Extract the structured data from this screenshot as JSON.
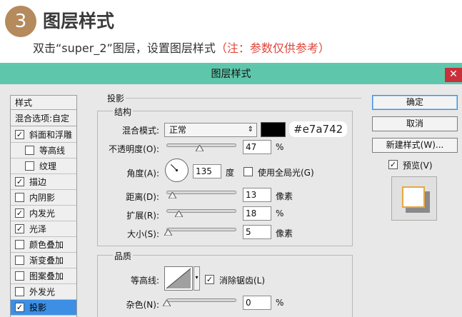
{
  "header": {
    "step_number": "3",
    "step_title": "图层样式",
    "description": "双击“super_2”图层，设置图层样式",
    "note": "（注：参数仅供参考）"
  },
  "dialog": {
    "title": "图层样式",
    "close_glyph": "✕",
    "styles_list": {
      "header": "样式",
      "blend_options": "混合选项:自定",
      "items": [
        {
          "label": "斜面和浮雕",
          "checked": true,
          "indent": false,
          "selected": false
        },
        {
          "label": "等高线",
          "checked": false,
          "indent": true,
          "selected": false
        },
        {
          "label": "纹理",
          "checked": false,
          "indent": true,
          "selected": false
        },
        {
          "label": "描边",
          "checked": true,
          "indent": false,
          "selected": false
        },
        {
          "label": "内阴影",
          "checked": false,
          "indent": false,
          "selected": false
        },
        {
          "label": "内发光",
          "checked": true,
          "indent": false,
          "selected": false
        },
        {
          "label": "光泽",
          "checked": true,
          "indent": false,
          "selected": false
        },
        {
          "label": "颜色叠加",
          "checked": false,
          "indent": false,
          "selected": false
        },
        {
          "label": "渐变叠加",
          "checked": false,
          "indent": false,
          "selected": false
        },
        {
          "label": "图案叠加",
          "checked": false,
          "indent": false,
          "selected": false
        },
        {
          "label": "外发光",
          "checked": false,
          "indent": false,
          "selected": false
        },
        {
          "label": "投影",
          "checked": true,
          "indent": false,
          "selected": true
        }
      ]
    },
    "shadow": {
      "section_title": "投影",
      "structure_title": "结构",
      "blend_mode_label": "混合模式:",
      "blend_mode_value": "正常",
      "color_hex_label": "#e7a742",
      "swatch_color": "#000000",
      "opacity_label": "不透明度(O):",
      "opacity_value": "47",
      "opacity_fraction": 0.47,
      "percent": "%",
      "angle_label": "角度(A):",
      "angle_value": "135",
      "angle_unit": "度",
      "global_light_label": "使用全局光(G)",
      "global_light_checked": false,
      "distance_label": "距离(D):",
      "distance_value": "13",
      "distance_fraction": 0.09,
      "pixel_unit": "像素",
      "spread_label": "扩展(R):",
      "spread_value": "18",
      "spread_fraction": 0.18,
      "size_label": "大小(S):",
      "size_value": "5",
      "size_fraction": 0.03,
      "quality_title": "品质",
      "contour_label": "等高线:",
      "antialias_label": "消除锯齿(L)",
      "antialias_checked": true,
      "noise_label": "杂色(N):",
      "noise_value": "0",
      "noise_fraction": 0.0
    },
    "buttons": {
      "ok": "确定",
      "cancel": "取消",
      "new_style": "新建样式(W)...",
      "preview_label": "预览(V)",
      "preview_checked": true
    },
    "colors": {
      "titlebar": "#5ec7ab",
      "selection": "#3c8fe5",
      "close": "#c9303a",
      "preview_accent": "#e7a742"
    }
  }
}
